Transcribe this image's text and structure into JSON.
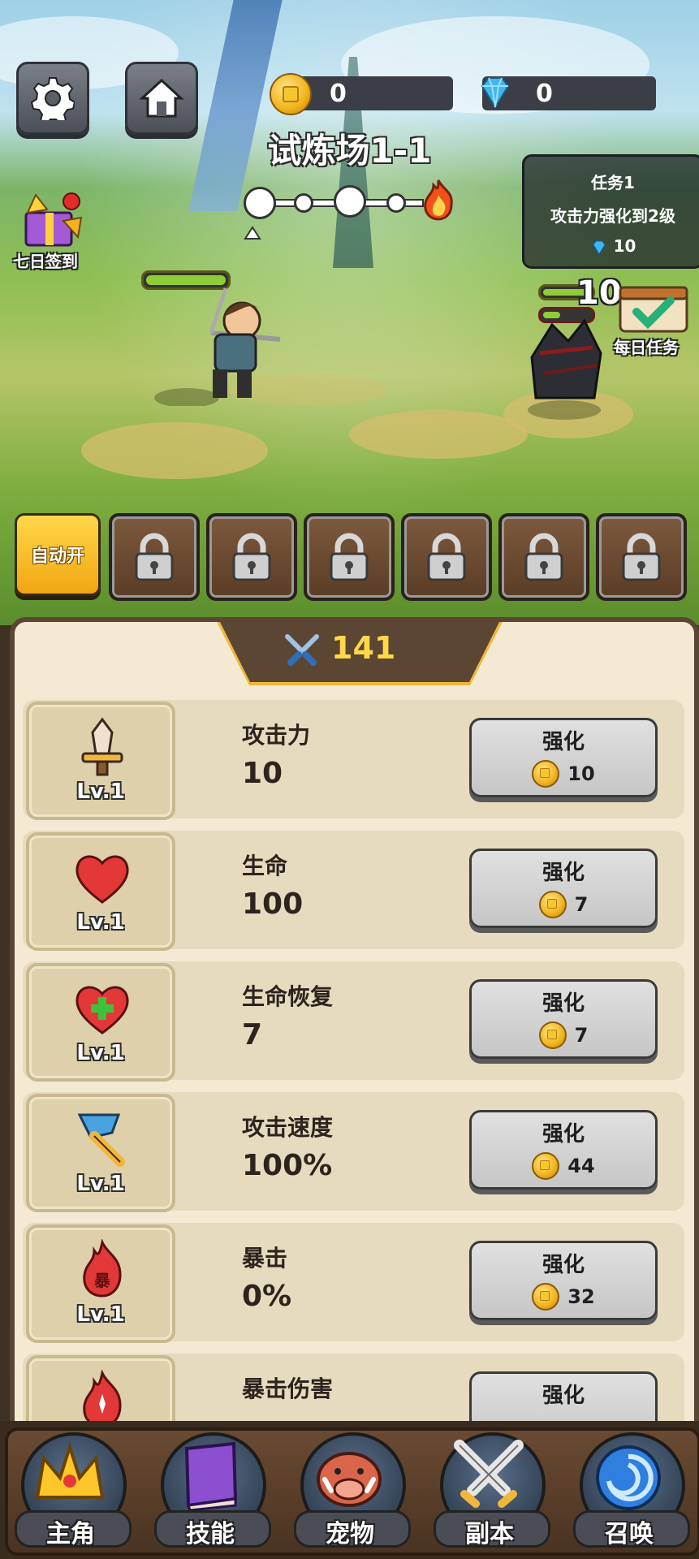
{
  "top_bar": {
    "gold": "0",
    "diamonds": "0",
    "stage_title": "试炼场1-1"
  },
  "side_buttons": {
    "seven_day_checkin": "七日签到",
    "daily_tasks": "每日任务"
  },
  "task": {
    "title": "任务1",
    "description": "攻击力强化到2级",
    "reward": "10"
  },
  "battle": {
    "enemy_damage_popup": "10"
  },
  "skill_bar": {
    "auto_label": "自动开",
    "locked_slots": 6
  },
  "panel": {
    "combat_power": "141",
    "upgrade_label": "强化",
    "stats": [
      {
        "name": "攻击力",
        "value": "10",
        "level": "Lv.1",
        "cost": "10",
        "icon": "sword-icon"
      },
      {
        "name": "生命",
        "value": "100",
        "level": "Lv.1",
        "cost": "7",
        "icon": "heart-icon"
      },
      {
        "name": "生命恢复",
        "value": "7",
        "level": "Lv.1",
        "cost": "7",
        "icon": "heart-plus-icon"
      },
      {
        "name": "攻击速度",
        "value": "100%",
        "level": "Lv.1",
        "cost": "44",
        "icon": "axe-icon"
      },
      {
        "name": "暴击",
        "value": "0%",
        "level": "Lv.1",
        "cost": "32",
        "icon": "crit-flame-icon",
        "icon_text": "暴"
      },
      {
        "name": "暴击伤害",
        "value": "",
        "level": "",
        "cost": "",
        "icon": "crit-damage-flame-icon"
      }
    ]
  },
  "nav": {
    "items": [
      {
        "label": "主角",
        "icon": "crown-icon"
      },
      {
        "label": "技能",
        "icon": "spellbook-icon"
      },
      {
        "label": "宠物",
        "icon": "boar-icon"
      },
      {
        "label": "副本",
        "icon": "crossed-swords-icon"
      },
      {
        "label": "召唤",
        "icon": "portal-icon"
      }
    ]
  }
}
